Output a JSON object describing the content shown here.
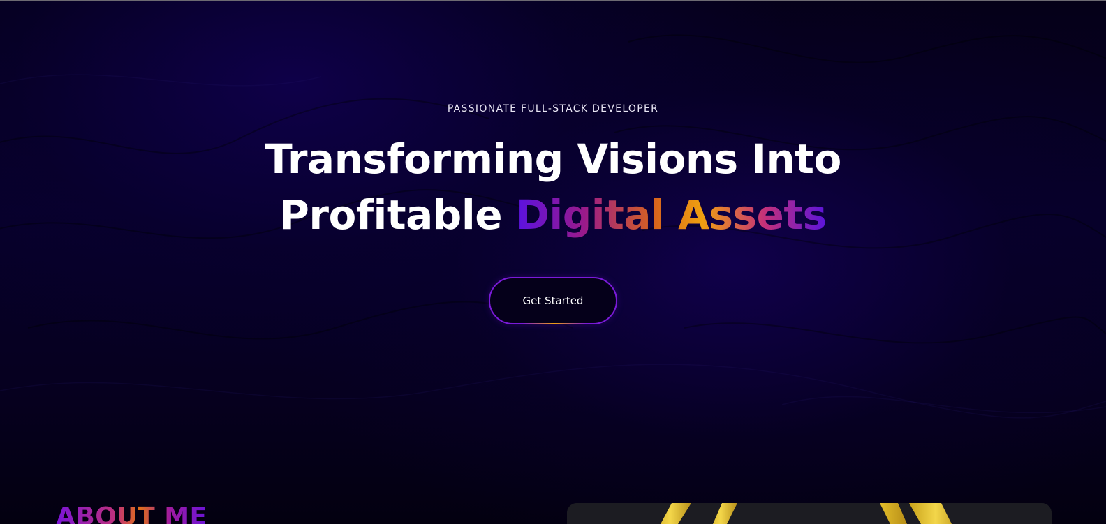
{
  "hero": {
    "eyebrow": "PASSIONATE FULL-STACK DEVELOPER",
    "headline_line1": "Transforming Visions Into",
    "headline_line2_plain": "Profitable",
    "headline_line2_highlight": "Digital Assets",
    "cta_label": "Get Started"
  },
  "about": {
    "title": "ABOUT ME"
  },
  "colors": {
    "background": "#040012",
    "accent_purple": "#7a1ad8",
    "accent_orange": "#f0a010",
    "accent_magenta": "#c0307a",
    "text": "#ffffff"
  }
}
